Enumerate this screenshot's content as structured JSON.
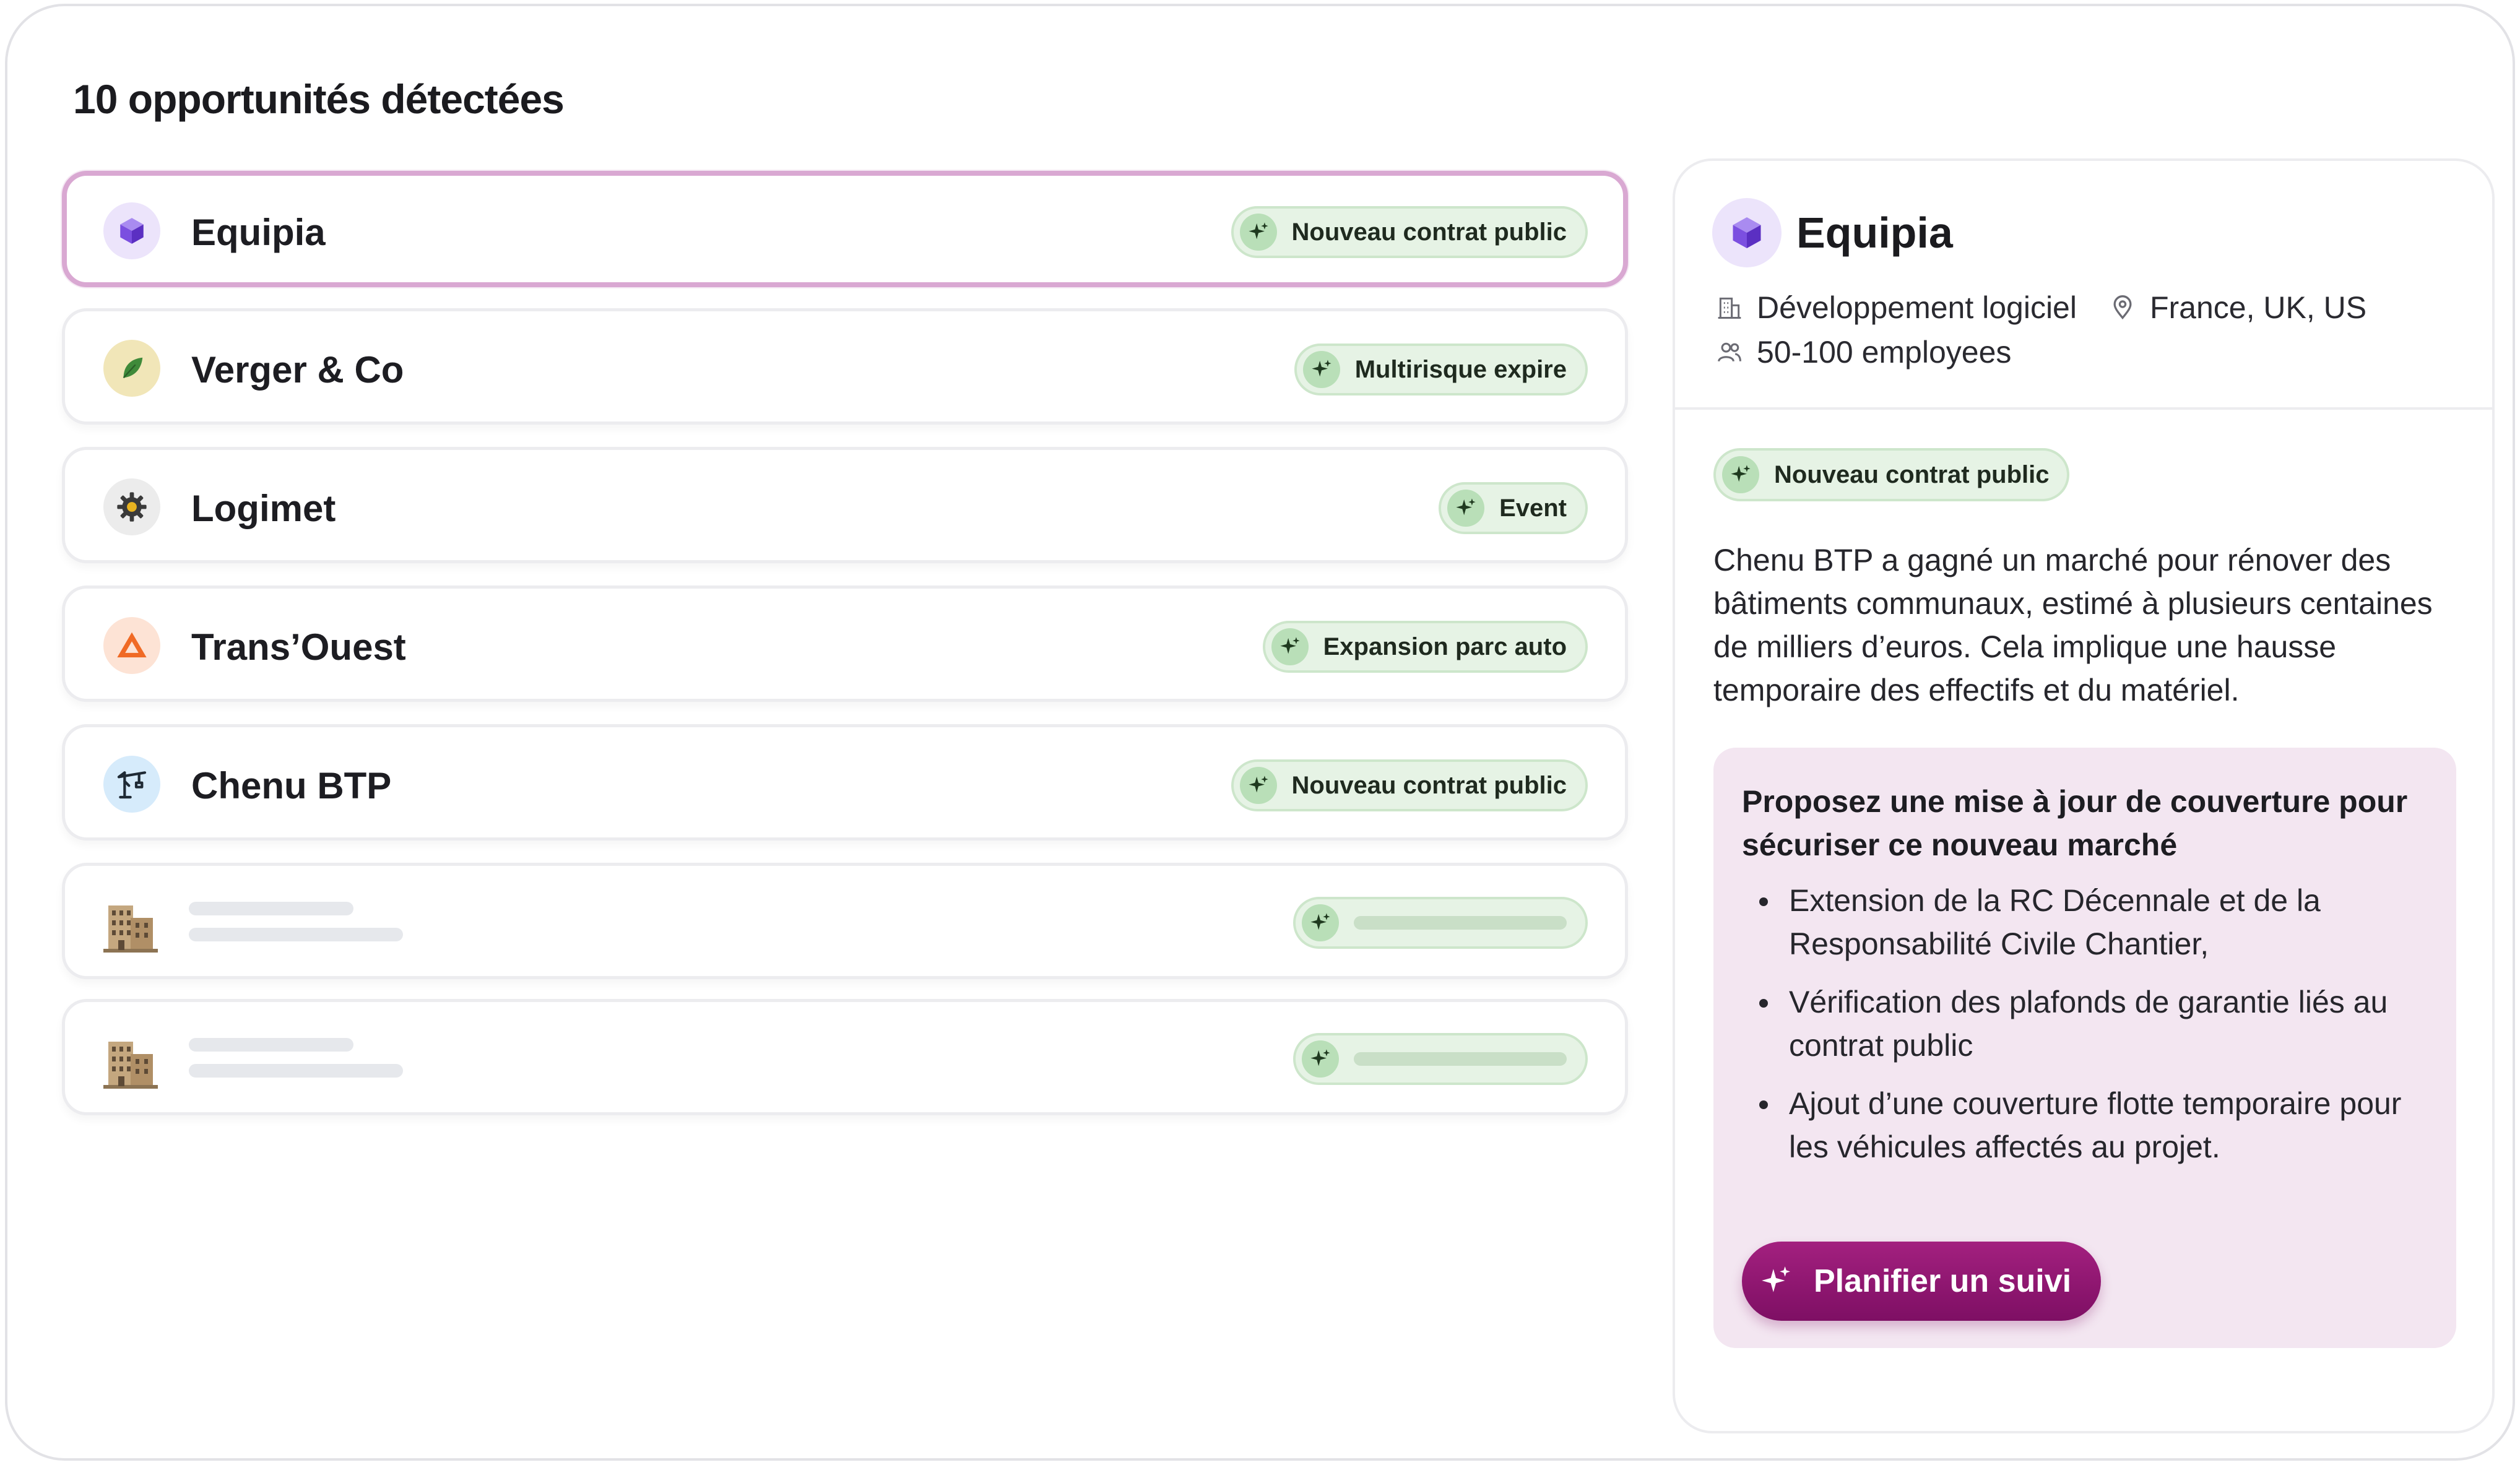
{
  "page": {
    "title": "10 opportunités détectées"
  },
  "opportunities": [
    {
      "name": "Equipia",
      "tag": "Nouveau contrat public",
      "icon": "cube-icon",
      "avatar_bg": "#ece4fb",
      "selected": true
    },
    {
      "name": "Verger & Co",
      "tag": "Multirisque expire",
      "icon": "leaf-icon",
      "avatar_bg": "#f1e6b8"
    },
    {
      "name": "Logimet",
      "tag": "Event",
      "icon": "gear-icon",
      "avatar_bg": "#ececec"
    },
    {
      "name": "Trans’Ouest",
      "tag": "Expansion parc auto",
      "icon": "warning-triangle-icon",
      "avatar_bg": "#fde3d5"
    },
    {
      "name": "Chenu BTP",
      "tag": "Nouveau contrat public",
      "icon": "crane-icon",
      "avatar_bg": "#d6ebfb"
    }
  ],
  "placeholders": [
    {
      "icon": "building-icon"
    },
    {
      "icon": "building-icon"
    }
  ],
  "detail": {
    "name": "Equipia",
    "industry": "Développement logiciel",
    "location": "France, UK, US",
    "employees": "50-100 employees",
    "tag": "Nouveau contrat public",
    "description": "Chenu BTP a gagné un marché pour rénover des bâtiments communaux, estimé à plusieurs centaines de milliers d’euros. Cela implique une hausse temporaire des effectifs et du matériel.",
    "recommendation": {
      "title": "Proposez une mise à jour de couverture pour sécuriser ce nouveau marché",
      "items": [
        "Extension de la RC Décennale et de la Responsabilité Civile Chantier,",
        "Vérification des plafonds de garantie liés au contrat public",
        "Ajout d’une couverture flotte temporaire pour les véhicules affectés au projet."
      ],
      "cta": "Planifier un suivi"
    }
  },
  "colors": {
    "selected_border": "#d9a8d2",
    "tag_bg": "#e6f3e5",
    "tag_icon_bg": "#b9dfb8",
    "reco_bg": "#f3e6f1",
    "cta": "#8f1772"
  }
}
